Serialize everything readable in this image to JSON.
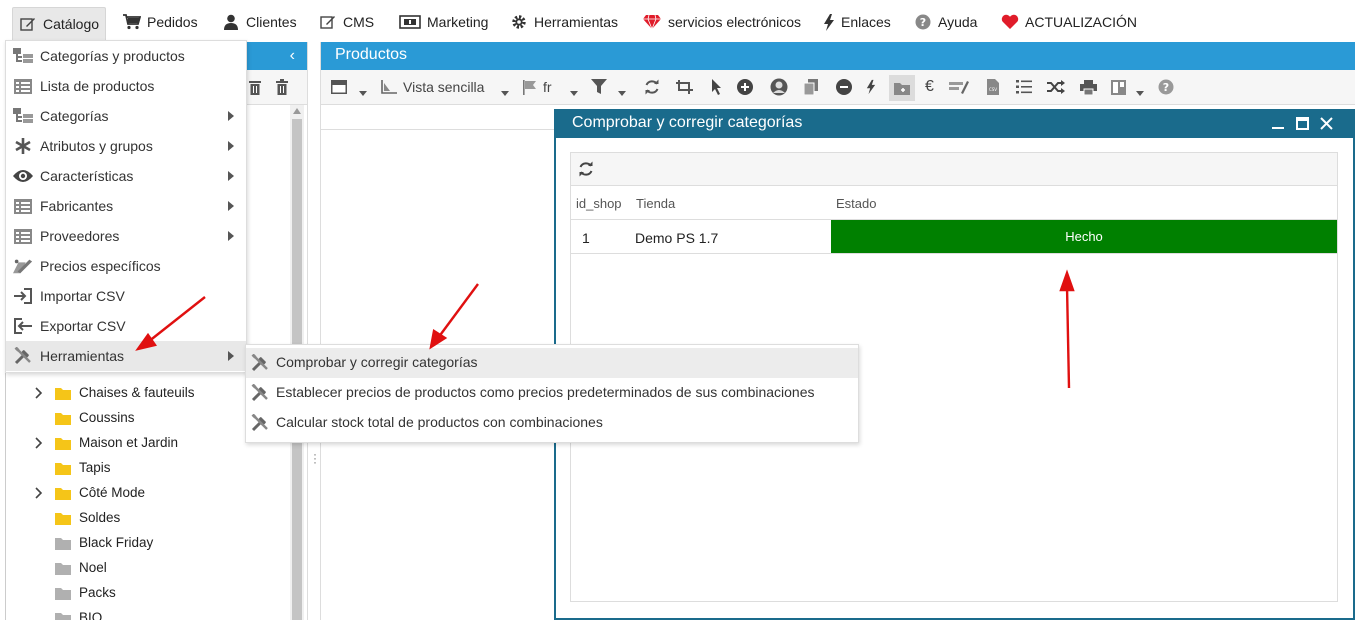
{
  "top_menu": [
    {
      "label": "Catálogo",
      "icon": "edit-icon",
      "active": true
    },
    {
      "label": "Pedidos",
      "icon": "cart-icon"
    },
    {
      "label": "Clientes",
      "icon": "user-icon"
    },
    {
      "label": "CMS",
      "icon": "edit-icon"
    },
    {
      "label": "Marketing",
      "icon": "ticket-icon"
    },
    {
      "label": "Herramientas",
      "icon": "gear-icon"
    },
    {
      "label": "servicios electrónicos",
      "icon": "diamond-icon"
    },
    {
      "label": "Enlaces",
      "icon": "bolt-icon"
    },
    {
      "label": "Ayuda",
      "icon": "help-icon"
    },
    {
      "label": "ACTUALIZACIÓN",
      "icon": "heart-icon"
    }
  ],
  "catalog_menu": [
    {
      "label": "Categorías y productos",
      "icon": "tree-icon",
      "submenu": false
    },
    {
      "label": "Lista de productos",
      "icon": "list-icon",
      "submenu": false
    },
    {
      "label": "Categorías",
      "icon": "tree-icon",
      "submenu": true
    },
    {
      "label": "Atributos y grupos",
      "icon": "asterisk-icon",
      "submenu": true
    },
    {
      "label": "Características",
      "icon": "eye-icon",
      "submenu": true
    },
    {
      "label": "Fabricantes",
      "icon": "list-icon",
      "submenu": true
    },
    {
      "label": "Proveedores",
      "icon": "list-icon",
      "submenu": true
    },
    {
      "label": "Precios específicos",
      "icon": "price-tag-icon",
      "submenu": false
    },
    {
      "label": "Importar CSV",
      "icon": "import-icon",
      "submenu": false
    },
    {
      "label": "Exportar CSV",
      "icon": "export-icon",
      "submenu": false
    },
    {
      "label": "Herramientas",
      "icon": "tools-icon",
      "submenu": true,
      "highlighted": true
    }
  ],
  "tools_submenu": [
    {
      "label": "Comprobar y corregir categorías",
      "icon": "tools-icon",
      "highlighted": true
    },
    {
      "label": "Establecer precios de productos como precios predeterminados de sus combinaciones",
      "icon": "tools-icon"
    },
    {
      "label": "Calcular stock total de productos con combinaciones",
      "icon": "tools-icon"
    }
  ],
  "category_tree": [
    {
      "label": "Chaises & fauteuils",
      "expandable": true,
      "color": "#f5c518"
    },
    {
      "label": "Coussins",
      "expandable": false,
      "color": "#f5c518"
    },
    {
      "label": "Maison et Jardin",
      "expandable": true,
      "color": "#f5c518"
    },
    {
      "label": "Tapis",
      "expandable": false,
      "color": "#f5c518"
    },
    {
      "label": "Côté Mode",
      "expandable": true,
      "color": "#f5c518"
    },
    {
      "label": "Soldes",
      "expandable": false,
      "color": "#f5c518"
    },
    {
      "label": "Black Friday",
      "expandable": false,
      "color": "#b0b0b0"
    },
    {
      "label": "Noel",
      "expandable": false,
      "color": "#b0b0b0"
    },
    {
      "label": "Packs",
      "expandable": false,
      "color": "#b0b0b0"
    },
    {
      "label": "BIO",
      "expandable": false,
      "color": "#b0b0b0"
    }
  ],
  "products_panel": {
    "title": "Productos",
    "view_label": "Vista sencilla",
    "lang_label": "fr"
  },
  "dialog": {
    "title": "Comprobar y corregir categorías",
    "columns": [
      "id_shop",
      "Tienda",
      "Estado"
    ],
    "rows": [
      {
        "id_shop": "1",
        "tienda": "Demo PS 1.7",
        "estado": "Hecho"
      }
    ]
  },
  "colors": {
    "header_blue": "#2a9ad6",
    "dialog_header": "#1a6b8c",
    "status_done": "#008000",
    "annotation_arrow": "#e01010"
  }
}
